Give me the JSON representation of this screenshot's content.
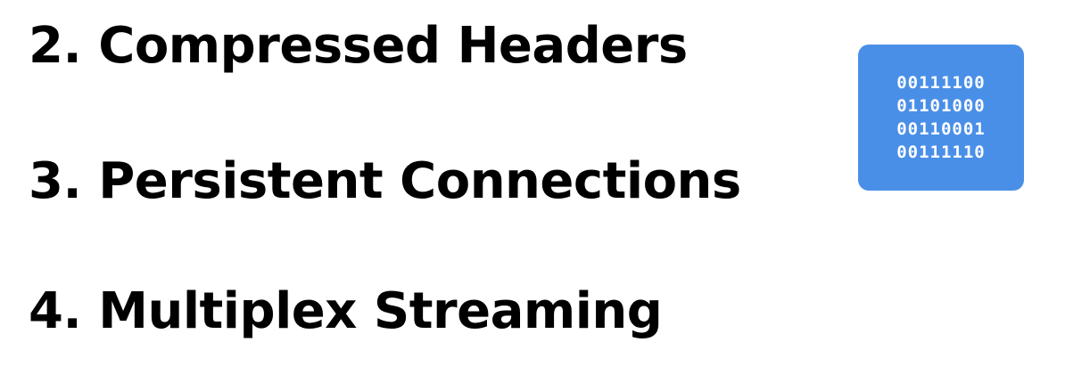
{
  "slide": {
    "items": [
      "2. Compressed Headers",
      "3. Persistent Connections",
      "4. Multiplex Streaming"
    ]
  },
  "binary_card": {
    "lines": [
      "00111100",
      "01101000",
      "00110001",
      "00111110"
    ],
    "background_color": "#4a8fe7",
    "text_color": "#ffffff"
  }
}
